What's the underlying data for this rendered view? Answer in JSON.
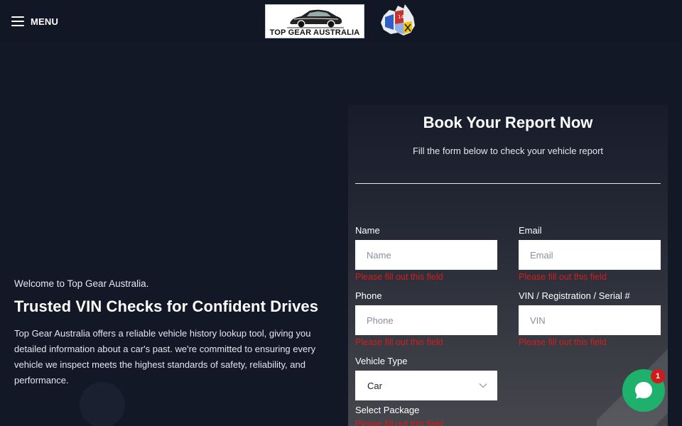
{
  "header": {
    "menu_label": "MENU",
    "logo_text": "TOP GEAR AUSTRALIA"
  },
  "hero": {
    "welcome": "Welcome to Top Gear Australia.",
    "headline": "Trusted VIN Checks for Confident Drives",
    "description": "Top Gear Australia offers a reliable vehicle history lookup tool, giving you detailed information about a car's past. we're committed to ensuring every vehicle we inspect meets the highest standards of safety, reliability, and performance."
  },
  "form": {
    "title": "Book Your Report Now",
    "subtitle": "Fill the form below to check your vehicle report",
    "name": {
      "label": "Name",
      "placeholder": "Name",
      "error": "Please fill out this field"
    },
    "email": {
      "label": "Email",
      "placeholder": "Email",
      "error": "Please fill out this field"
    },
    "phone": {
      "label": "Phone",
      "placeholder": "Phone",
      "error": "Please fill out this field"
    },
    "vin": {
      "label": "VIN / Registration / Serial #",
      "placeholder": "VIN",
      "error": "Please fill out this field"
    },
    "vehicle_type": {
      "label": "Vehicle Type",
      "value": "Car"
    },
    "package": {
      "label": "Select Package",
      "error": "Please fill out this field"
    }
  },
  "chat": {
    "badge_count": "1"
  },
  "colors": {
    "background": "#131827",
    "error": "#d21d1d",
    "chat_green": "#1db16c",
    "badge_red": "#d11a1a"
  },
  "icons": {
    "menu": "hamburger-icon",
    "logo": "sports-car-icon",
    "badge": "australia-map-icon",
    "select": "chevron-down-icon",
    "chat": "chat-bubble-icon"
  }
}
